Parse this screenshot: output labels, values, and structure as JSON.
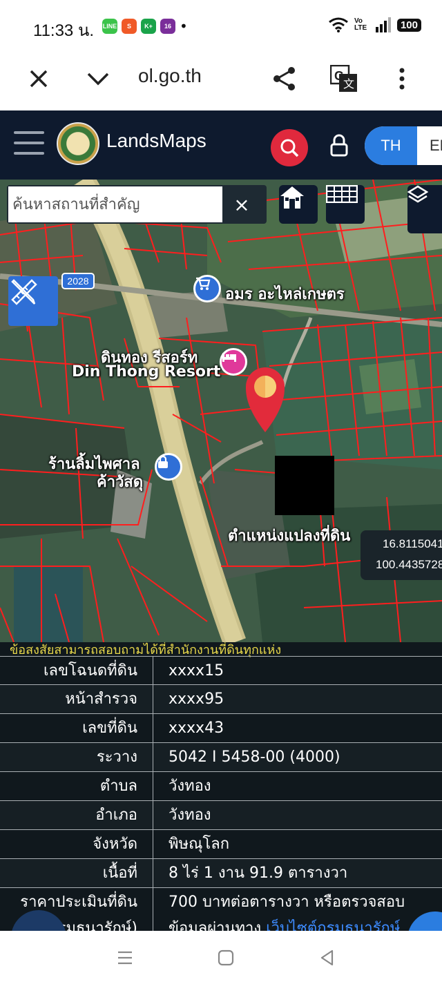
{
  "status_bar": {
    "time": "11:33 น.",
    "apps": [
      {
        "name": "line-app-icon",
        "label": "LINE",
        "color": "#3bc34a"
      },
      {
        "name": "shopee-app-icon",
        "label": "S",
        "color": "#f05a28"
      },
      {
        "name": "kplus-app-icon",
        "label": "K+",
        "color": "#1aa34a"
      },
      {
        "name": "ch16-app-icon",
        "label": "16",
        "color": "#7a2e9a"
      }
    ],
    "dot": "•",
    "network": "Vo LTE",
    "battery": "100"
  },
  "browser": {
    "url": "ol.go.th"
  },
  "app_header": {
    "brand": "LandsMaps",
    "lang_active": "TH",
    "lang_other": "EN",
    "colors": {
      "header_bg": "#0e1a2e",
      "search_red": "#e0293d",
      "lang_blue": "#2b7de0"
    }
  },
  "map": {
    "search_placeholder": "ค้นหาสถานที่สำคัญ",
    "clear_symbol": "×",
    "road_label": "2028",
    "labels": {
      "shop_amorn": "อมร อะไหล่เกษตร",
      "resort_th": "ดินทอง รีสอร์ท",
      "resort_en": "Din Thong Resort",
      "store_line1": "ร้านลิ้มไพศาล",
      "store_line2": "ค้าวัสดุ",
      "parcel_location": "ตำแหน่งแปลงที่ดิน"
    },
    "coords": {
      "lat": "16.8115041",
      "lon": "100.4435728"
    }
  },
  "info": {
    "notice": "ข้อสงสัยสามารถสอบถามได้ที่สำนักงานที่ดินทุกแห่ง",
    "rows": [
      {
        "label": "เลขโฉนดที่ดิน",
        "value": "xxxx15"
      },
      {
        "label": "หน้าสำรวจ",
        "value": "xxxx95"
      },
      {
        "label": "เลขที่ดิน",
        "value": "xxxx43"
      },
      {
        "label": "ระวาง",
        "value": "5042 I 5458-00 (4000)"
      },
      {
        "label": "ตำบล",
        "value": "วังทอง"
      },
      {
        "label": "อำเภอ",
        "value": "วังทอง"
      },
      {
        "label": "จังหวัด",
        "value": "พิษณุโลก"
      },
      {
        "label": "เนื้อที่",
        "value": "8 ไร่ 1 งาน 91.9 ตารางวา"
      }
    ],
    "price_label_1": "ราคาประเมินที่ดิน",
    "price_label_2": "(กรมธนารักษ์)",
    "price_value_1": "700 บาทต่อตารางวา หรือตรวจสอบ",
    "price_value_2a": "ข้อมูลผ่านทาง",
    "price_value_2b": "เว็บไซต์กรมธนารักษ์"
  }
}
